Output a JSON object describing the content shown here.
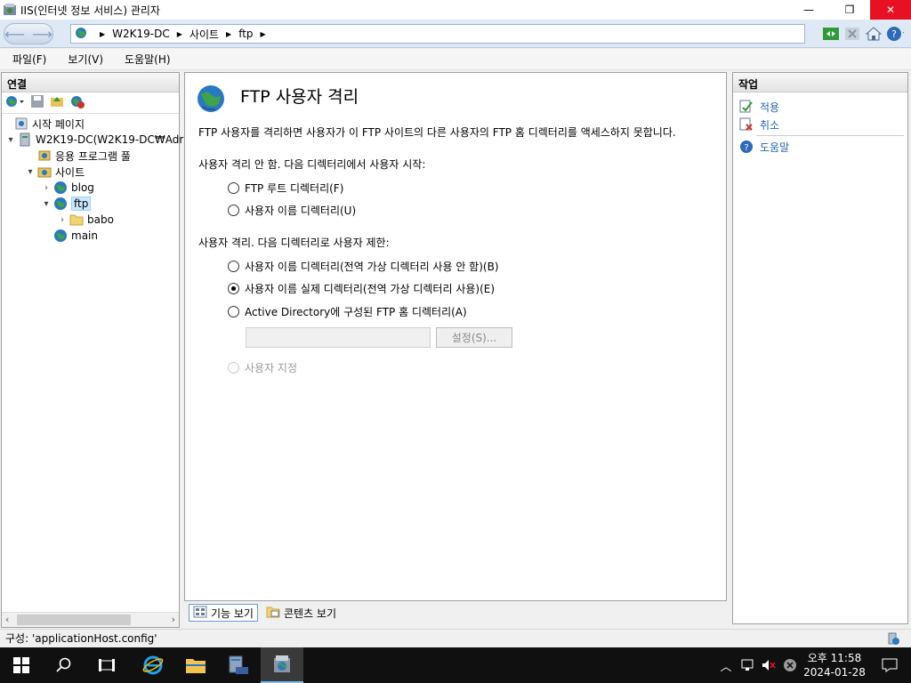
{
  "window": {
    "title": "IIS(인터넷 정보 서비스) 관리자",
    "minimize": "—",
    "restore": "❐",
    "close": "✕"
  },
  "address": {
    "crumbs": [
      "W2K19-DC",
      "사이트",
      "ftp"
    ]
  },
  "menu": [
    "파일(F)",
    "보기(V)",
    "도움말(H)"
  ],
  "connections": {
    "header": "연결",
    "tree": [
      {
        "label": "시작 페이지"
      },
      {
        "label": "W2K19-DC(W2K19-DC₩Adr"
      },
      {
        "label": "응용 프로그램 풀"
      },
      {
        "label": "사이트"
      },
      {
        "label": "blog"
      },
      {
        "label": "ftp"
      },
      {
        "label": "babo"
      },
      {
        "label": "main"
      }
    ]
  },
  "content": {
    "title": "FTP 사용자 격리",
    "description": "FTP 사용자를 격리하면 사용자가 이 FTP 사이트의 다른 사용자의 FTP 홈 디렉터리를 액세스하지 못합니다.",
    "section1": "사용자 격리 안 함. 다음 디렉터리에서 사용자 시작:",
    "section2": "사용자 격리. 다음 디렉터리로 사용자 제한:",
    "options": [
      {
        "label": "FTP 루트 디렉터리(F)",
        "checked": false
      },
      {
        "label": "사용자 이름 디렉터리(U)",
        "checked": false
      },
      {
        "label": "사용자 이름 디렉터리(전역 가상 디렉터리 사용 안 함)(B)",
        "checked": false
      },
      {
        "label": "사용자 이름 실제 디렉터리(전역 가상 디렉터리 사용)(E)",
        "checked": true
      },
      {
        "label": "Active Directory에 구성된 FTP 홈 디렉터리(A)",
        "checked": false
      },
      {
        "label": "사용자 지정",
        "checked": false
      }
    ],
    "settings_button": "설정(S)..."
  },
  "view_tabs": {
    "features": "기능 보기",
    "content": "콘텐츠 보기"
  },
  "actions": {
    "header": "작업",
    "items": [
      {
        "label": "적용"
      },
      {
        "label": "취소"
      },
      {
        "label": "도움말"
      }
    ]
  },
  "status": {
    "text": "구성: 'applicationHost.config'"
  },
  "taskbar": {
    "time": "오후 11:58",
    "date": "2024-01-28"
  },
  "colors": {
    "accent": "#2867b2",
    "close_red": "#e81123",
    "taskbar": "#101010"
  }
}
